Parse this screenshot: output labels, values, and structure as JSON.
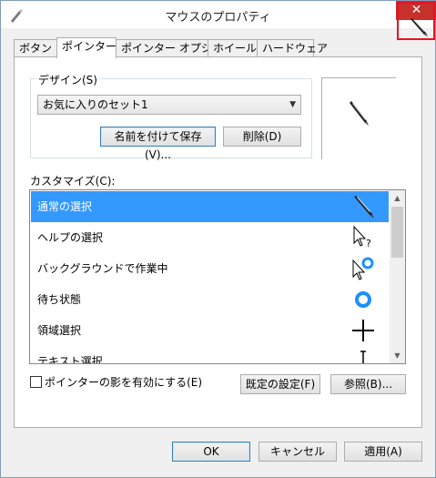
{
  "window": {
    "title": "マウスのプロパティ",
    "close_glyph": "✕"
  },
  "tabs": [
    {
      "label": "ボタン",
      "active": false
    },
    {
      "label": "ポインター",
      "active": true
    },
    {
      "label": "ポインター オプション",
      "active": false
    },
    {
      "label": "ホイール",
      "active": false
    },
    {
      "label": "ハードウェア",
      "active": false
    }
  ],
  "design": {
    "group_label": "デザイン(S)",
    "selected_scheme": "お気に入りのセット1",
    "save_as_label": "名前を付けて保存(V)...",
    "delete_label": "削除(D)"
  },
  "customize": {
    "label": "カスタマイズ(C):",
    "items": [
      {
        "label": "通常の選択",
        "icon": "pen-cursor-icon",
        "selected": true
      },
      {
        "label": "ヘルプの選択",
        "icon": "help-cursor-icon",
        "selected": false
      },
      {
        "label": "バックグラウンドで作業中",
        "icon": "busy-background-cursor-icon",
        "selected": false
      },
      {
        "label": "待ち状態",
        "icon": "busy-ring-icon",
        "selected": false
      },
      {
        "label": "領域選択",
        "icon": "crosshair-icon",
        "selected": false
      },
      {
        "label": "テキスト選択",
        "icon": "ibeam-icon",
        "selected": false
      }
    ]
  },
  "shadow_checkbox": {
    "label": "ポインターの影を有効にする(E)",
    "checked": false
  },
  "buttons": {
    "default": "既定の設定(F)",
    "browse": "参照(B)...",
    "ok": "OK",
    "cancel": "キャンセル",
    "apply": "適用(A)"
  },
  "colors": {
    "selection": "#3399ff",
    "close_button": "#c7302b",
    "highlight_box": "#e81123"
  }
}
